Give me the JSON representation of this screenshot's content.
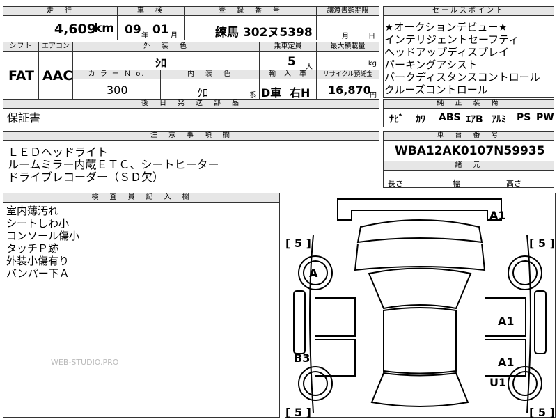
{
  "top": {
    "mileage_header": "走　行",
    "mileage": "4,609",
    "mileage_unit": "km",
    "inspection_header": "車　検",
    "inspection_year": "09",
    "year_unit": "年",
    "inspection_month": "01",
    "month_unit": "月",
    "reg_header": "登　録　番　号",
    "registration": "練馬 302ヌ5398",
    "transfer_header": "譲渡書類期限",
    "transfer_month": "月",
    "transfer_day": "日"
  },
  "row2": {
    "shift_header": "シフト",
    "ac_header": "エアコン",
    "color_header": "外　装　色",
    "capacity_header": "乗車定員",
    "load_header": "最大積載量",
    "shift": "FAT",
    "ac": "AAC",
    "exterior_color": "ｼﾛ",
    "capacity": "5",
    "capacity_unit": "人",
    "load_unit": "kg",
    "color_no_header": "カ ラ ー Ｎ o.",
    "interior_header": "内　装　色",
    "import_header": "輸　入　車",
    "recycle_header": "リサイクル預託金",
    "color_no": "300",
    "interior_color": "ｸﾛ",
    "interior_suffix": "系",
    "import_type": "D車",
    "steering": "右H",
    "recycle_fee": "16,870",
    "recycle_unit": "円"
  },
  "parts": {
    "header": "後　日　発　送　部　品",
    "value": "保証書"
  },
  "notes": {
    "header": "注　意　事　項　欄",
    "lines": [
      "ＬＥＤヘッドライト",
      "ルームミラー内蔵ＥＴＣ、シートヒーター",
      "ドライブレコーダー（ＳＤ欠）"
    ]
  },
  "selling": {
    "header": "セールスポイント",
    "lines": [
      "★オークションデビュー★",
      "インテリジェントセーフティ",
      "ヘッドアップディスプレイ",
      "パーキングアシスト",
      "パークディスタンスコントロール",
      "クルーズコントロール"
    ]
  },
  "equipment": {
    "header": "純　正　装　備",
    "items": [
      "ﾅﾋﾞ",
      "ｶﾜ",
      "ABS",
      "ｴｱB",
      "ｱﾙﾐ",
      "PS",
      "PW"
    ]
  },
  "vin": {
    "header": "車　台　番　号",
    "value": "WBA12AK0107N59935"
  },
  "specs": {
    "header": "諸　元",
    "length": "長さ",
    "width": "幅",
    "height": "高さ"
  },
  "inspector": {
    "header": "検　査　員　記　入　欄",
    "lines": [
      "室内薄汚れ",
      "シートしわ小",
      "コンソール傷小",
      "タッチＰ跡",
      "外装小傷有り",
      "バンパー下Ａ"
    ]
  },
  "watermark": "WEB-STUDIO.PRO",
  "diagram": {
    "code_a1_front": "A1",
    "code_a_front_left_tire": "A",
    "code_a1_right_front_door": "A1",
    "code_a1_right_rear_door": "A1",
    "code_u1_right_rear_tire": "U1",
    "code_b3_left_rear": "B3",
    "tread_fl": "[ 5 ]",
    "tread_fr": "[ 5 ]",
    "tread_rl": "[ 5 ]",
    "tread_rr": "[ 5 ]"
  }
}
